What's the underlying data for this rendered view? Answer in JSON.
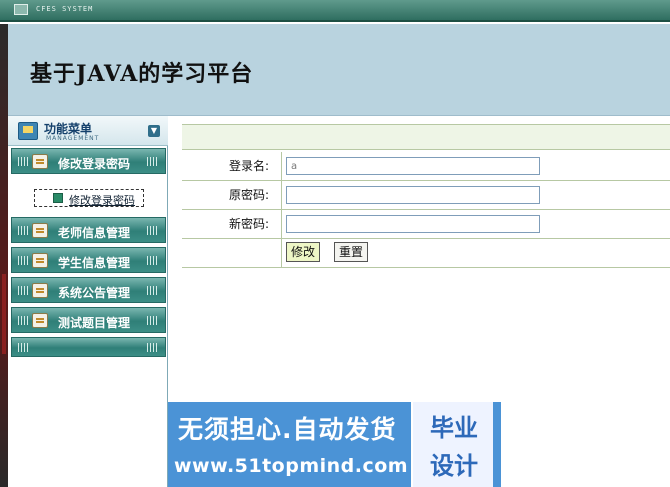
{
  "system_bar": {
    "label": "CFES SYSTEM"
  },
  "header": {
    "title": "基于JAVA的学习平台"
  },
  "sidebar": {
    "menu_title": "功能菜单",
    "menu_subtitle": "MANAGEMENT",
    "items": [
      {
        "label": "修改登录密码"
      },
      {
        "label": "老师信息管理"
      },
      {
        "label": "学生信息管理"
      },
      {
        "label": "系统公告管理"
      },
      {
        "label": "测试题目管理"
      }
    ],
    "sub_item": {
      "label": "修改登录密码"
    }
  },
  "form": {
    "username_label": "登录名:",
    "username_value": "a",
    "old_password_label": "原密码:",
    "old_password_value": "",
    "new_password_label": "新密码:",
    "new_password_value": "",
    "submit_label": "修改",
    "reset_label": "重置"
  },
  "promo": {
    "slogan": "无须担心.自动发货",
    "site": "www.51topmind.com",
    "badge_line1": "毕业",
    "badge_line2": "设计"
  },
  "colors": {
    "nav_bar": "#2f7f78",
    "header_bg": "#b9d3df",
    "promo_bg": "#4b93d6"
  }
}
